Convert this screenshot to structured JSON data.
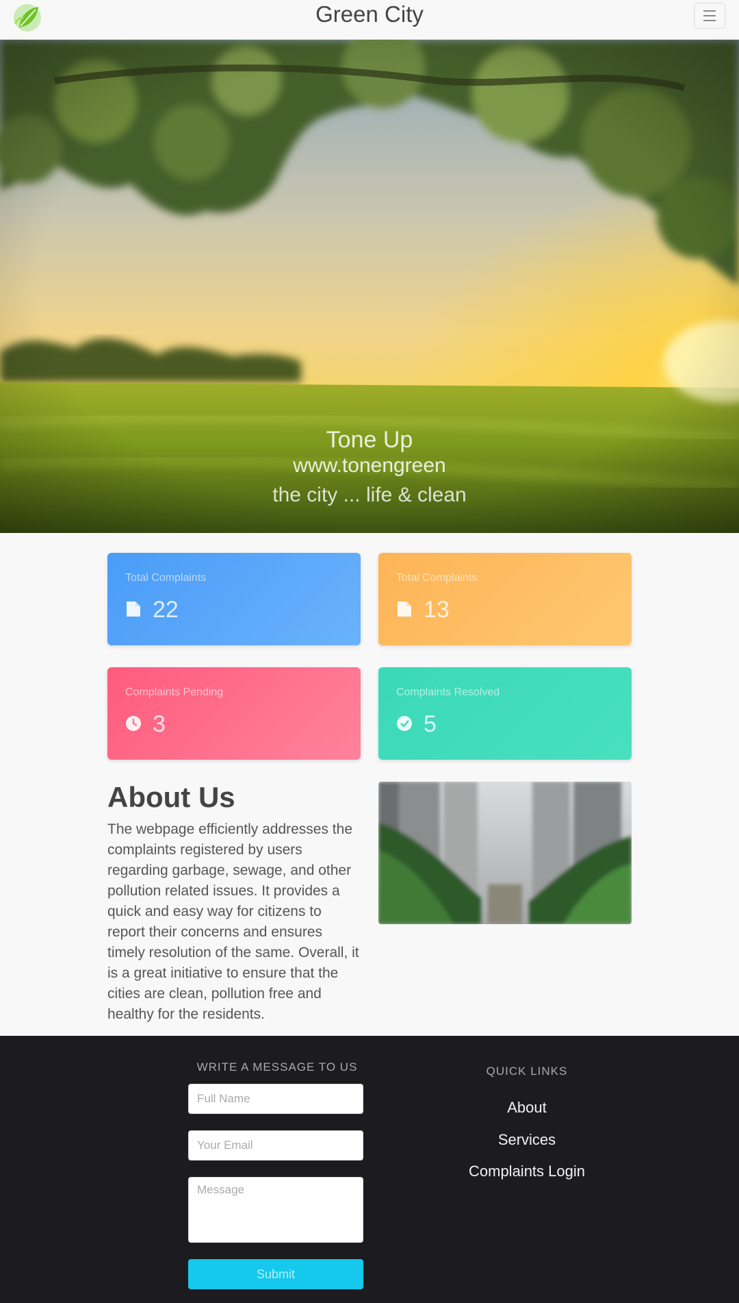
{
  "navbar": {
    "brand": "Green City",
    "logo_icon": "leaf-logo-icon",
    "menu_icon": "hamburger-icon"
  },
  "hero": {
    "line1": "Tone Up",
    "line2": "www.tonengreen",
    "line3": "the city ... life & clean"
  },
  "stats": [
    {
      "label": "Total Complaints",
      "value": "22",
      "icon": "file-icon",
      "color": "#4a9cf8"
    },
    {
      "label": "Total Complaints",
      "value": "13",
      "icon": "file-icon",
      "color": "#fdb455"
    },
    {
      "label": "Complaints Pending",
      "value": "3",
      "icon": "clock-icon",
      "color": "#ff5b7d"
    },
    {
      "label": "Complaints Resolved",
      "value": "5",
      "icon": "check-icon",
      "color": "#3bd8b8"
    }
  ],
  "about": {
    "title": "About Us",
    "text": "The webpage efficiently addresses the complaints registered by users regarding garbage, sewage, and other pollution related issues. It provides a quick and easy way for citizens to report their concerns and ensures timely resolution of the same. Overall, it is a great initiative to ensure that the cities are clean, pollution free and healthy for the residents."
  },
  "footer": {
    "form_title": "WRITE A MESSAGE TO US",
    "name_placeholder": "Full Name",
    "email_placeholder": "Your Email",
    "message_placeholder": "Message",
    "submit_label": "Submit",
    "links_title": "QUICK LINKS",
    "links": [
      "About",
      "Services",
      "Complaints Login"
    ]
  }
}
